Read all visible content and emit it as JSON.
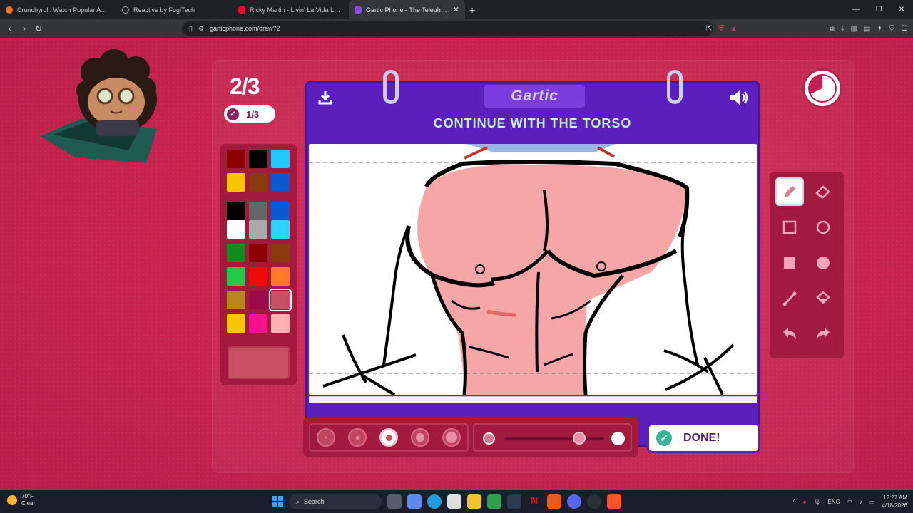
{
  "browser": {
    "tabs": [
      {
        "title": "Crunchyroll: Watch Popular Anime, Pl",
        "icon": "crunchyroll-icon",
        "color": "#f47521"
      },
      {
        "title": "Reactive by FugiTech",
        "icon": "globe-icon",
        "color": "#9aa0a6"
      },
      {
        "title": "Ricky Martin - Livin' La Vida Loca (au",
        "icon": "youtube-icon",
        "color": "#ff0033"
      },
      {
        "title": "Gartic Phone - The Telephone Ga",
        "icon": "gartic-icon",
        "color": "#8c4ae8"
      }
    ],
    "url": "garticphone.com/draw?2"
  },
  "game": {
    "round": "2/3",
    "done_count": "1/3",
    "logo": "Gartic",
    "prompt": "CONTINUE WITH THE TORSO",
    "done_label": "DONE!",
    "palette": [
      "#8b0000",
      "#000000",
      "#1ec9ff",
      "#f7c600",
      "#8b3a0e",
      "#0a5ad6",
      "#000000",
      "#666666",
      "#0a5ad6",
      "#ffffff",
      "#aaaaaa",
      "#2ed2ff",
      "#118a1e",
      "#8b0000",
      "#8b3a0e",
      "#23c94a",
      "#f00a0a",
      "#ff7a22",
      "#b8861c",
      "#9c0a4c",
      "#c94f63",
      "#f7c600",
      "#f7118a",
      "#ffb0b0"
    ],
    "selected_color": "#c94f63",
    "selected_color_index": 20,
    "brush_size_selected": 3,
    "opacity_level": 0.75,
    "tools": [
      "pencil-icon",
      "eraser-icon",
      "rectangle-outline-icon",
      "circle-outline-icon",
      "rectangle-fill-icon",
      "circle-fill-icon",
      "line-icon",
      "fill-bucket-icon",
      "undo-icon",
      "redo-icon"
    ],
    "selected_tool": "pencil-icon",
    "accent": "#5b1fbe",
    "background": "#c8244f"
  },
  "taskbar": {
    "weather_temp": "70°F",
    "weather_desc": "Clear",
    "search": "Search",
    "lang": "ENG",
    "time": "12:27 AM",
    "date": "4/18/2026"
  }
}
